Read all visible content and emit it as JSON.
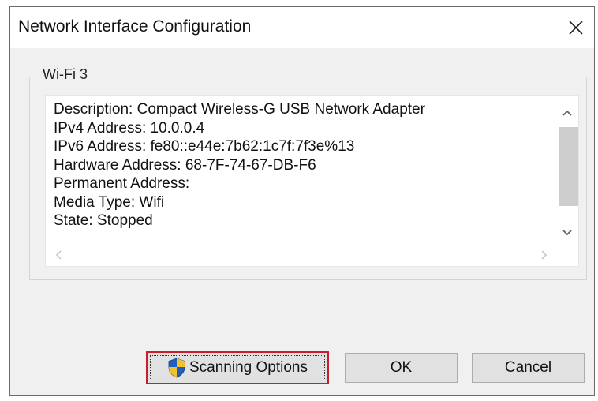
{
  "window": {
    "title": "Network Interface Configuration",
    "close_icon": "close-icon"
  },
  "group": {
    "label": "Wi-Fi 3"
  },
  "details": {
    "lines": [
      "Description: Compact Wireless-G USB Network Adapter",
      "IPv4 Address: 10.0.0.4",
      "IPv6 Address: fe80::e44e:7b62:1c7f:7f3e%13",
      "Hardware Address: 68-7F-74-67-DB-F6",
      "Permanent Address:",
      "Media Type: Wifi",
      "State: Stopped"
    ]
  },
  "buttons": {
    "scanning_options": "Scanning Options",
    "ok": "OK",
    "cancel": "Cancel"
  },
  "colors": {
    "highlight_border": "#c81e2b",
    "shield_blue": "#1f5fbf",
    "shield_gold": "#f2c12e"
  }
}
